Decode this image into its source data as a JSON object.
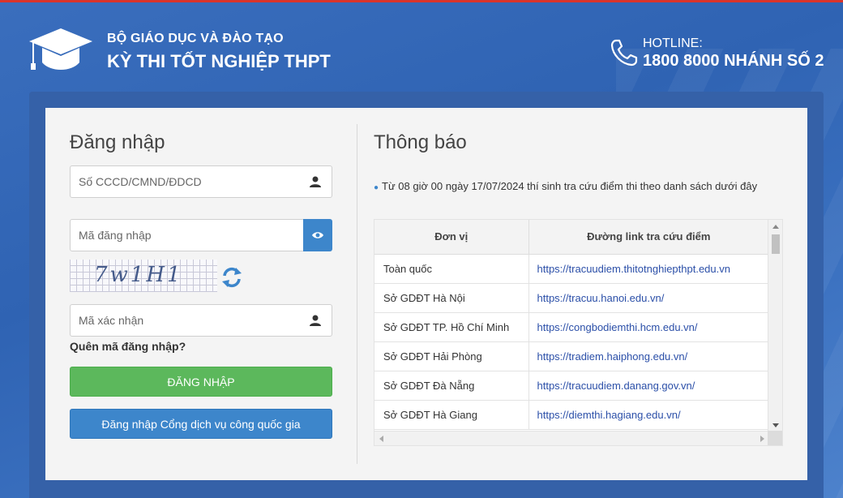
{
  "header": {
    "org": "BỘ GIÁO DỤC VÀ ĐÀO TẠO",
    "exam": "KỲ THI TỐT NGHIỆP THPT",
    "hotline_label": "HOTLINE:",
    "hotline_number": "1800 8000 NHÁNH SỐ 2"
  },
  "login": {
    "title": "Đăng nhập",
    "id_placeholder": "Số CCCD/CMND/ĐDCD",
    "code_placeholder": "Mã đăng nhập",
    "captcha_text": "7w1H1",
    "verify_placeholder": "Mã xác nhận",
    "forgot_label": "Quên mã đăng nhập?",
    "login_button": "ĐĂNG NHẬP",
    "gov_button": "Đăng nhập Cổng dịch vụ công quốc gia"
  },
  "notice": {
    "title": "Thông báo",
    "text": "Từ 08 giờ 00 ngày 17/07/2024 thí sinh tra cứu điểm thi theo danh sách dưới đây",
    "table": {
      "headers": [
        "Đơn vị",
        "Đường link tra cứu điểm"
      ],
      "rows": [
        {
          "unit": "Toàn quốc",
          "link": "https://tracuudiem.thitotnghiepthpt.edu.vn"
        },
        {
          "unit": "Sở GDĐT Hà Nội",
          "link": "https://tracuu.hanoi.edu.vn/"
        },
        {
          "unit": "Sở GDĐT TP. Hồ Chí Minh",
          "link": "https://congbodiemthi.hcm.edu.vn/"
        },
        {
          "unit": "Sở GDĐT Hải Phòng",
          "link": "https://tradiem.haiphong.edu.vn/"
        },
        {
          "unit": "Sở GDĐT Đà Nẵng",
          "link": "https://tracuudiem.danang.gov.vn/"
        },
        {
          "unit": "Sở GDĐT Hà Giang",
          "link": "https://diemthi.hagiang.edu.vn/"
        }
      ]
    }
  },
  "colors": {
    "accent_red": "#d9342b",
    "primary_blue": "#3d86cb",
    "success_green": "#5cb85c",
    "link_blue": "#2b4fa8"
  },
  "icons": {
    "logo": "graduation-cap-icon",
    "hotline": "phone-icon",
    "id_field": "user-icon",
    "show_code": "eye-icon",
    "captcha_refresh": "refresh-icon"
  }
}
